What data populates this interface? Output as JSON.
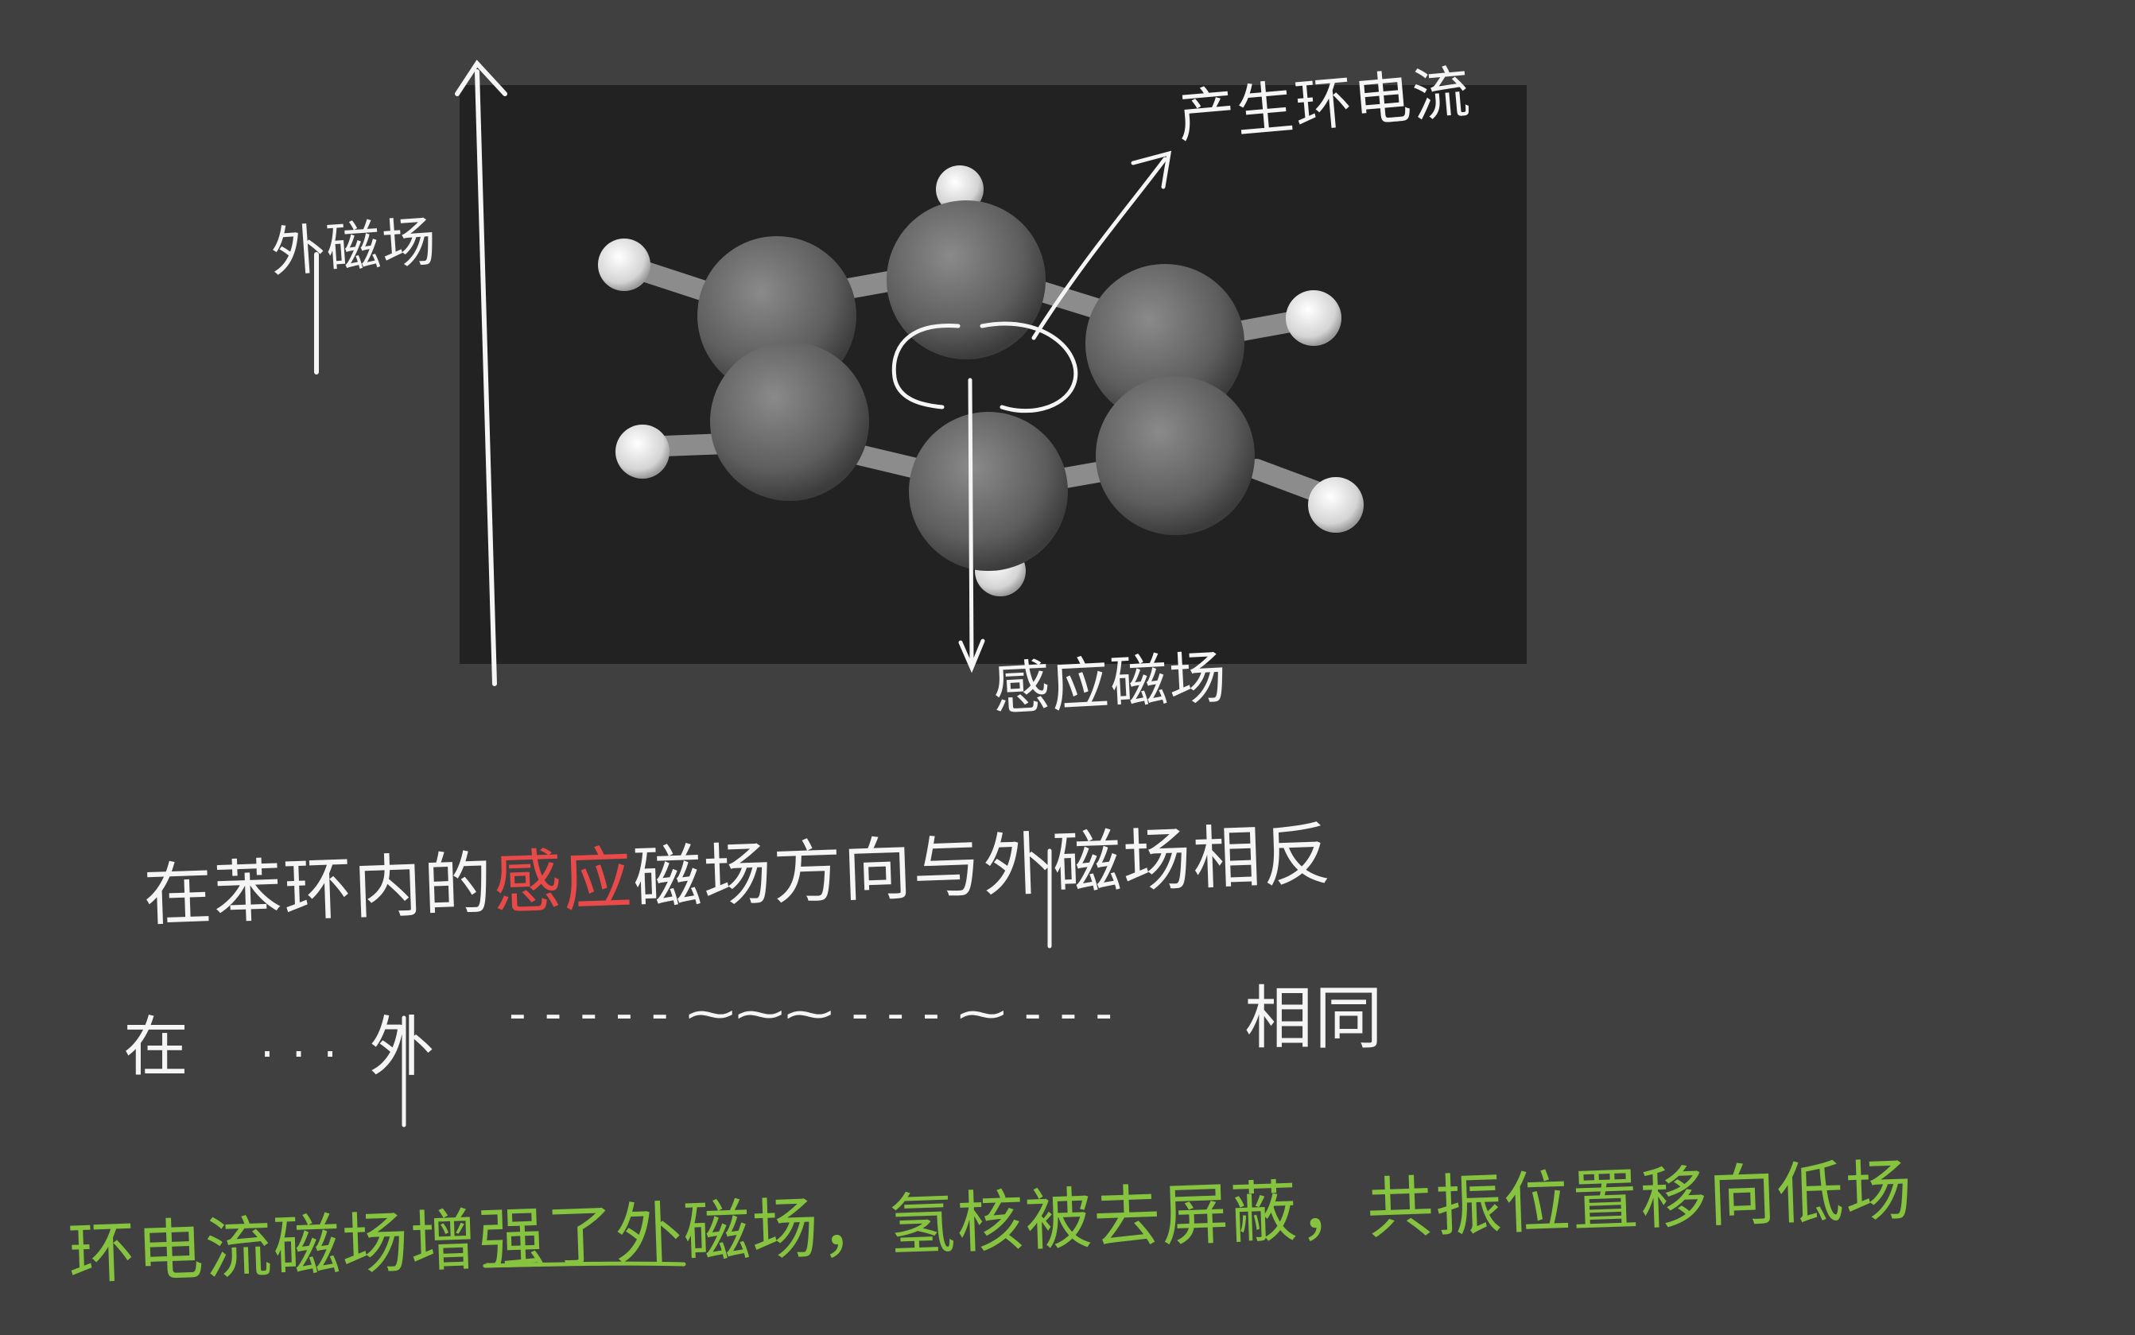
{
  "colors": {
    "background": "#404040",
    "panel": "#222222",
    "ink": "#f5f5f5",
    "highlight": "#e84a4a",
    "conclusion": "#86c440",
    "carbon_atom": "#6e6e6e",
    "hydrogen_atom": "#dcdcdc"
  },
  "diagram": {
    "labels": {
      "external_field": "外磁场",
      "ring_current": "产生环电流",
      "induced_field": "感应磁场"
    },
    "molecule": {
      "name_hint": "benzene-model",
      "carbon_count": 6,
      "hydrogen_count": 6
    }
  },
  "notes": {
    "line1_part1": "在苯环内的",
    "line1_highlight": "感应",
    "line1_part2": "磁场方向与外磁场相反",
    "line2_part1": "在",
    "line2_dots1": "·  ·  ·",
    "line2_part2": "外",
    "line2_dashes": "- - -     - - ⁓⁓⁓     - - - ⁓ - - -",
    "line2_end": "相同",
    "line3": "环电流磁场增强了外磁场，氢核被去屏蔽，共振位置移向低场"
  }
}
